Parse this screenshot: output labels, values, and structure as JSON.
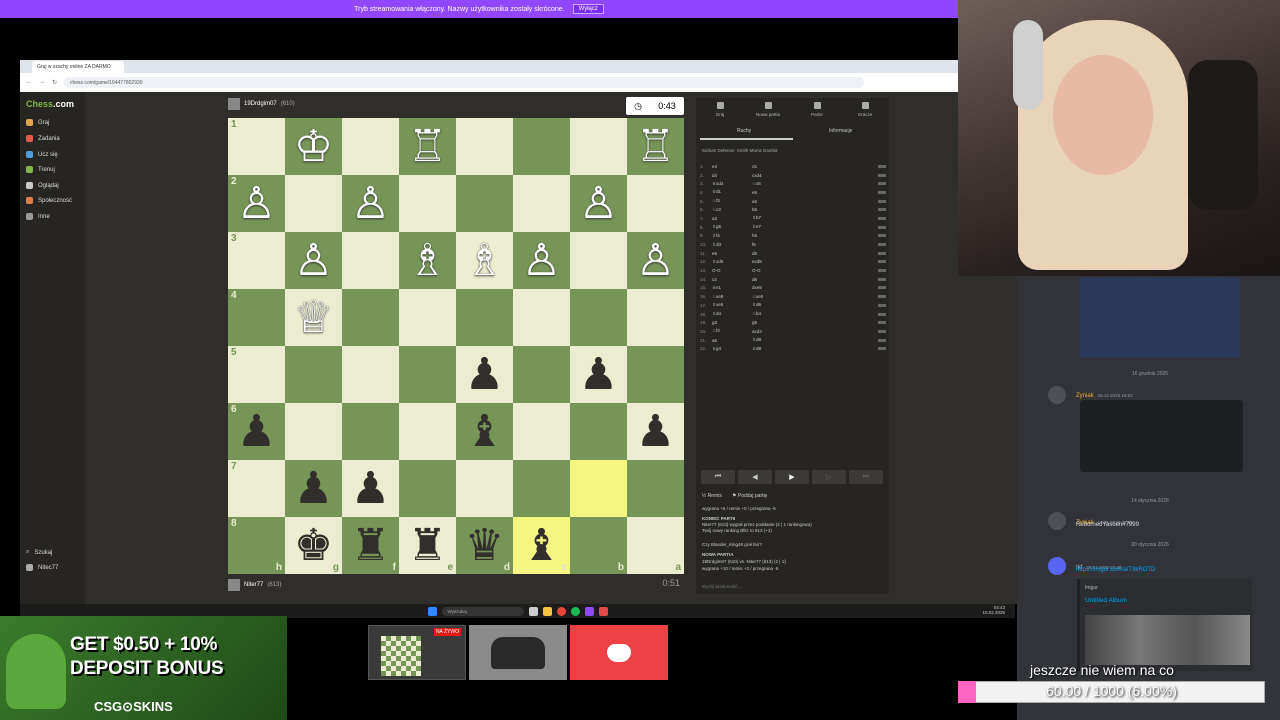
{
  "notice": {
    "text": "Tryb streamowania włączony. Nazwy użytkownika zostały skrócone.",
    "button": "Wyłącz"
  },
  "browser": {
    "tab_title": "Graj w szachy online ZA DARMO",
    "url": "chess.com/game/164477802930"
  },
  "sidebar": {
    "brand_1": "Chess",
    "brand_2": ".com",
    "items": [
      "Graj",
      "Zadania",
      "Ucz się",
      "Trenuj",
      "Oglądaj",
      "Społeczność",
      "Inne"
    ],
    "search": "Szukaj",
    "user": "Nitec77"
  },
  "opponent": {
    "name": "19Drdgim07",
    "rating": "(610)",
    "time": "0:43"
  },
  "player": {
    "name": "Niter77",
    "rating": "(613)",
    "time": "0:51"
  },
  "board": {
    "orientation": "black",
    "squares": [
      [
        "",
        "♔",
        "",
        "♖",
        "",
        "",
        "",
        "♖"
      ],
      [
        "♙",
        "",
        "♙",
        "",
        "",
        "",
        "♙",
        ""
      ],
      [
        "",
        "♙",
        "",
        "♗",
        "♗",
        "♙",
        "",
        "♙"
      ],
      [
        "",
        "♕",
        "",
        "",
        "",
        "",
        "",
        ""
      ],
      [
        "",
        "",
        "",
        "",
        "♟",
        "",
        "♟",
        ""
      ],
      [
        "♟",
        "",
        "",
        "",
        "♝",
        "",
        "",
        "♟"
      ],
      [
        "",
        "♟",
        "♟",
        "",
        "",
        "",
        "",
        ""
      ],
      [
        "",
        "♚",
        "♜",
        "♜",
        "♛",
        "♝",
        "",
        ""
      ]
    ],
    "ranks": [
      "1",
      "2",
      "3",
      "4",
      "5",
      "6",
      "7",
      "8"
    ],
    "files": [
      "h",
      "g",
      "f",
      "e",
      "d",
      "c",
      "b",
      "a"
    ]
  },
  "panel": {
    "tabs": [
      "Graj",
      "Nowa partia",
      "Partie",
      "Gracze"
    ],
    "subtabs": [
      "Ruchy",
      "Informacje"
    ],
    "opening": "Sicilian Defense: Smith-Morra Gambit",
    "moves": [
      [
        "1.",
        "e4",
        "c5"
      ],
      [
        "2.",
        "d4",
        "cxd4"
      ],
      [
        "3.",
        "♕xd4",
        "♘c6"
      ],
      [
        "4.",
        "♕d1",
        "e6"
      ],
      [
        "5.",
        "♘f3",
        "a6"
      ],
      [
        "6.",
        "♘c3",
        "b5"
      ],
      [
        "7.",
        "a3",
        "♗b7"
      ],
      [
        "8.",
        "♗g5",
        "♗e7"
      ],
      [
        "9.",
        "♗f4",
        "h6"
      ],
      [
        "10.",
        "♗d3",
        "f6"
      ],
      [
        "11.",
        "e5",
        "d5"
      ],
      [
        "12.",
        "♗xd5",
        "exd5"
      ],
      [
        "13.",
        "O-O",
        "O-O"
      ],
      [
        "14.",
        "c3",
        "d6"
      ],
      [
        "15.",
        "♕e1",
        "dxe5"
      ],
      [
        "16.",
        "♘xe5",
        "♘xe5"
      ],
      [
        "17.",
        "♗xe5",
        "♗d6"
      ],
      [
        "18.",
        "♗d4",
        "♘b4"
      ],
      [
        "19.",
        "g3",
        "g5"
      ],
      [
        "20.",
        "♘f3",
        "axd3"
      ],
      [
        "21.",
        "a5",
        "♗d8"
      ],
      [
        "22.",
        "♕g4",
        "♕d8"
      ]
    ],
    "controls": [
      "⏮",
      "◀",
      "▶",
      "▷",
      "⏭"
    ],
    "actions": [
      "Remis",
      "Poddaj partię"
    ],
    "chat": [
      "wygrana +6 / remis +0 / przegrana -6",
      "KONIEC PARTII",
      "Niter77 (613) wygrał przez poddanie (2 | 1 rankingowa)",
      "Twój nowy ranking Blitz to 613 (+3)",
      "Czy Blander_King48 grał fair?",
      "NOWA PARTIA",
      "19Drdgim07 (610) vs. Niter77 (613) (2 | 1)",
      "wygrana +10 / remis +2 / przegrana -6"
    ],
    "chat_placeholder": "Wyślij wiadomość..."
  },
  "taskbar": {
    "search": "Wyszukaj",
    "time": "04:43",
    "date": "10.02.2026"
  },
  "discord": {
    "date1": "16 grudnia 2025",
    "msg1": {
      "user": "Zyniak",
      "time": "16.12.2025 18:52"
    },
    "date2": "14 stycznia 2026",
    "msg2": {
      "user": "Zyniak",
      "time": "14.01.2026 23:53",
      "text": "RebornedYasoen#7999"
    },
    "date3": "20 stycznia 2026",
    "msg3": {
      "user": "tkf",
      "time": "20.01.2026 03:48",
      "link": "https://imgur.com/a/T3kROTD",
      "embed_site": "Imgur",
      "embed_title": "Untitled Album"
    }
  },
  "ad": {
    "headline_1": "GET $0.50 + 10%",
    "headline_2": "DEPOSIT BONUS",
    "brand": "CSG⊙SKINS"
  },
  "live_badge": "NA ŻYWO",
  "goal": {
    "caption": "jeszcze nie wiem na co",
    "text": "60.00 / 1000 (6.00%)",
    "progress_percent": 6
  },
  "colors": {
    "twitch_purple": "#9147ff",
    "board_light": "#ebecd0",
    "board_dark": "#779556",
    "highlight": "#f5f682",
    "discord_red": "#ed4245"
  }
}
